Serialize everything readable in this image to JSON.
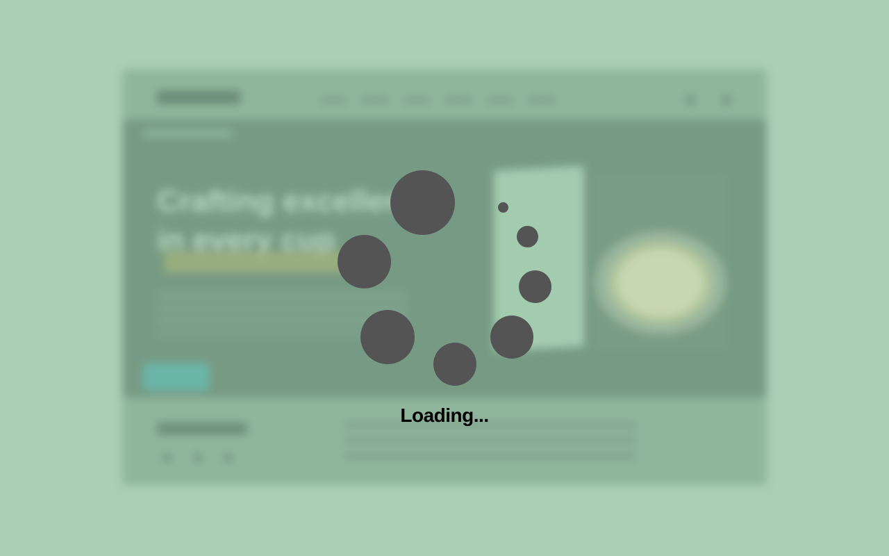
{
  "background": {
    "page_color": "#abcfb5"
  },
  "site_preview": {
    "hero_title": "Crafting excellence in every cup"
  },
  "loader": {
    "label": "Loading...",
    "dot_color": "#545454",
    "text_color": "#000000"
  }
}
